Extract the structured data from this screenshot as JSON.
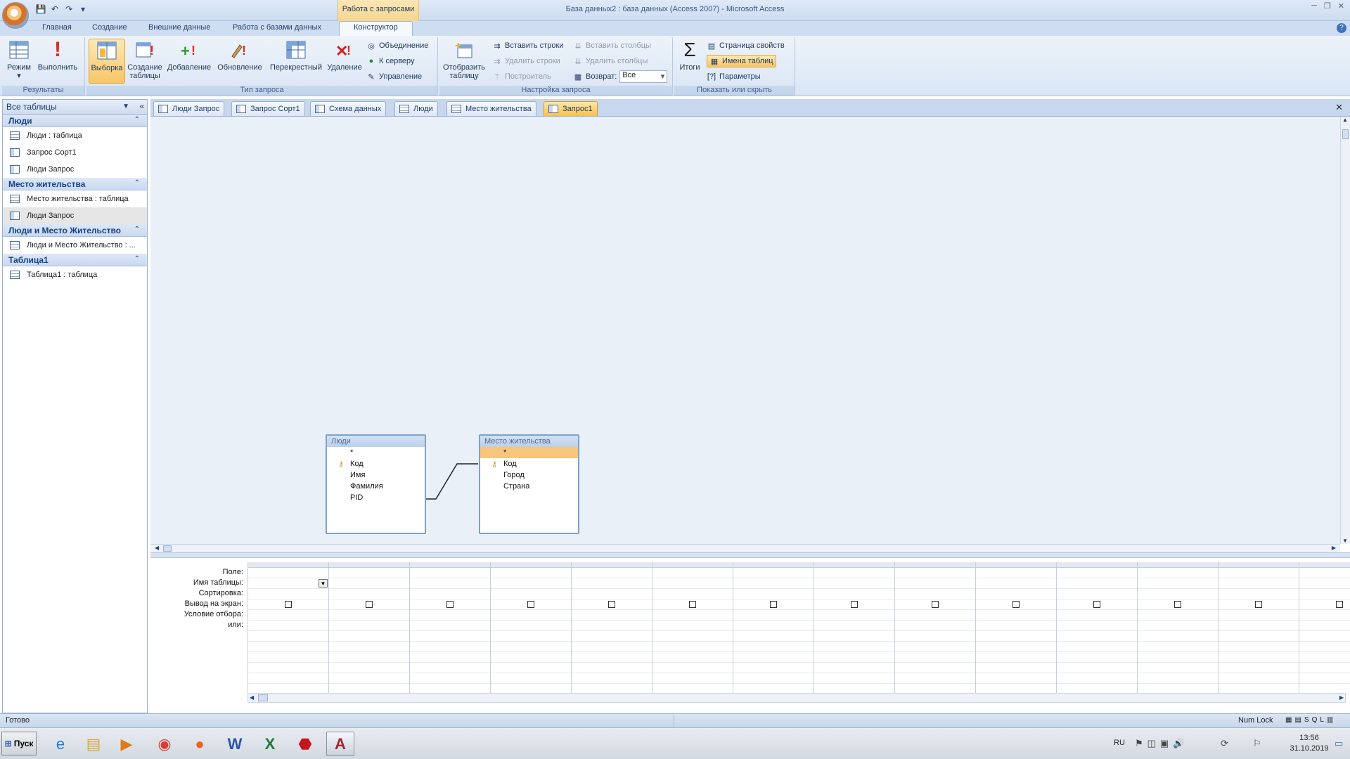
{
  "app": {
    "title": "База данных2 : база данных (Access 2007) - Microsoft Access",
    "context_group": "Работа с запросами",
    "window_controls": [
      "─",
      "❐",
      "✕"
    ]
  },
  "qat": {
    "items": [
      "save-icon",
      "undo-icon",
      "redo-icon",
      "customize-icon"
    ]
  },
  "ribbon": {
    "tabs": [
      "Главная",
      "Создание",
      "Внешние данные",
      "Работа с базами данных",
      "Конструктор"
    ],
    "active_tab": "Конструктор",
    "groups": {
      "results": {
        "label": "Результаты",
        "mode": "Режим",
        "run": "Выполнить"
      },
      "query_type": {
        "label": "Тип запроса",
        "select": "Выборка",
        "make_table": "Создание таблицы",
        "append": "Добавление",
        "update": "Обновление",
        "crosstab": "Перекрестный",
        "delete": "Удаление",
        "union": "Объединение",
        "to_server": "К серверу",
        "management": "Управление"
      },
      "query_setup": {
        "label": "Настройка запроса",
        "show_table": "Отобразить таблицу",
        "insert_rows": "Вставить строки",
        "delete_rows": "Удалить строки",
        "builder": "Построитель",
        "insert_cols": "Вставить столбцы",
        "delete_cols": "Удалить столбцы",
        "return_label": "Возврат:",
        "return_value": "Все"
      },
      "show_hide": {
        "label": "Показать или скрыть",
        "totals": "Итоги",
        "property_sheet": "Страница свойств",
        "table_names": "Имена таблиц",
        "parameters": "Параметры"
      }
    }
  },
  "nav": {
    "header": "Все таблицы",
    "groups": [
      {
        "name": "Люди",
        "items": [
          {
            "label": "Люди : таблица",
            "kind": "table"
          },
          {
            "label": "Запрос Сорт1",
            "kind": "query"
          },
          {
            "label": "Люди Запрос",
            "kind": "query"
          }
        ]
      },
      {
        "name": "Место жительства",
        "items": [
          {
            "label": "Место жительства : таблица",
            "kind": "table"
          },
          {
            "label": "Люди Запрос",
            "kind": "query"
          }
        ]
      },
      {
        "name": "Люди и Место Жительство",
        "items": [
          {
            "label": "Люди и Место Жительство : ...",
            "kind": "table"
          }
        ]
      },
      {
        "name": "Таблица1",
        "items": [
          {
            "label": "Таблица1 : таблица",
            "kind": "table"
          }
        ]
      }
    ]
  },
  "doc_tabs": [
    "Люди Запрос",
    "Запрос Сорт1",
    "Схема данных",
    "Люди",
    "Место жительства",
    "Запрос1"
  ],
  "active_doc_tab": "Запрос1",
  "designer": {
    "tables": [
      {
        "title": "Люди",
        "fields": [
          "*",
          "Код",
          "Имя",
          "Фамилия",
          "PID"
        ],
        "key_field": "Код"
      },
      {
        "title": "Место жительства",
        "fields": [
          "*",
          "Код",
          "Город",
          "Страна"
        ],
        "key_field": "Код"
      }
    ]
  },
  "grid": {
    "row_labels": [
      "Поле:",
      "Имя таблицы:",
      "Сортировка:",
      "Вывод на экран:",
      "Условие отбора:",
      "или:"
    ]
  },
  "status": {
    "left": "Готово",
    "numlock": "Num Lock"
  },
  "taskbar": {
    "start": "Пуск",
    "apps": [
      "ie-icon",
      "explorer-icon",
      "media-player-icon",
      "chrome-icon",
      "firefox-icon",
      "word-icon",
      "excel-icon",
      "acrobat-icon",
      "access-icon"
    ],
    "lang": "RU",
    "time": "13:56",
    "date": "31.10.2019"
  },
  "colors": {
    "accent": "#f6c24f",
    "ribbon": "#d9e5f4",
    "designer_bg": "#eaf0f7"
  }
}
